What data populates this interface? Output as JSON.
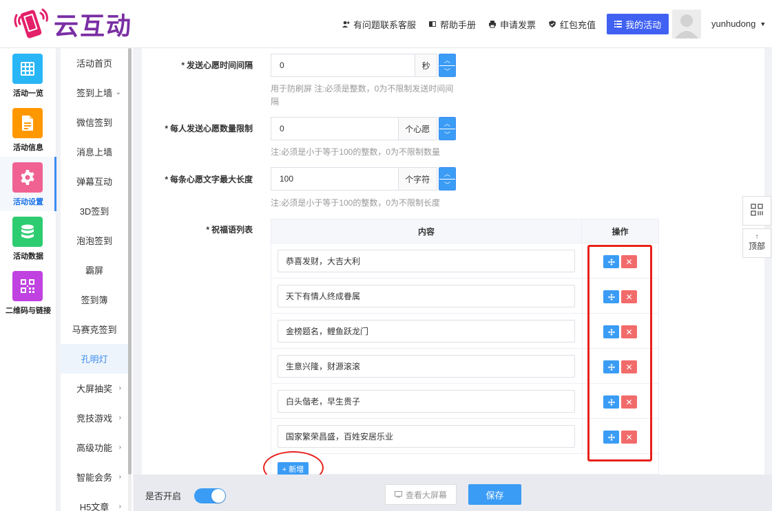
{
  "brand": {
    "name": "云互动",
    "colors": {
      "brand_purple": "#7a2ea3",
      "primary": "#3b9cf5",
      "nav_button": "#4061f2",
      "danger": "#f26b6b",
      "annotation": "#e8201b"
    }
  },
  "header": {
    "links": [
      {
        "label": "有问题联系客服",
        "icon": "user-plus-icon"
      },
      {
        "label": "帮助手册",
        "icon": "book-icon"
      },
      {
        "label": "申请发票",
        "icon": "printer-icon"
      },
      {
        "label": "红包充值",
        "icon": "shield-check-icon"
      }
    ],
    "my_activity": "我的活动",
    "username": "yunhudong"
  },
  "rail": [
    {
      "label": "活动一览",
      "icon": "grid-icon",
      "color": "#29b6f6"
    },
    {
      "label": "活动信息",
      "icon": "document-icon",
      "color": "#ff9800"
    },
    {
      "label": "活动设置",
      "icon": "gear-icon",
      "color": "#f06292",
      "active": true
    },
    {
      "label": "活动数据",
      "icon": "database-icon",
      "color": "#2ecc71"
    },
    {
      "label": "二维码与链接",
      "icon": "qrcode-icon",
      "color": "#c042e0"
    }
  ],
  "submenu": [
    {
      "label": "活动首页"
    },
    {
      "label": "签到上墙",
      "chevron": "⌄"
    },
    {
      "label": "微信签到"
    },
    {
      "label": "消息上墙"
    },
    {
      "label": "弹幕互动"
    },
    {
      "label": "3D签到"
    },
    {
      "label": "泡泡签到"
    },
    {
      "label": "霸屏"
    },
    {
      "label": "签到簿"
    },
    {
      "label": "马赛克签到"
    },
    {
      "label": "孔明灯",
      "active": true
    },
    {
      "label": "大屏抽奖",
      "chevron": "›"
    },
    {
      "label": "竞技游戏",
      "chevron": "›"
    },
    {
      "label": "高级功能",
      "chevron": "›"
    },
    {
      "label": "智能会务",
      "chevron": "›"
    },
    {
      "label": "H5文章",
      "chevron": "›"
    }
  ],
  "form": {
    "interval": {
      "label": "发送心愿时间间隔",
      "value": "0",
      "unit": "秒",
      "hint": "用于防刷屏 注:必须是整数，0为不限制发送时间间隔"
    },
    "count": {
      "label": "每人发送心愿数量限制",
      "value": "0",
      "unit": "个心愿",
      "hint": "注:必须是小于等于100的整数，0为不限制数量"
    },
    "length": {
      "label": "每条心愿文字最大长度",
      "value": "100",
      "unit": "个字符",
      "hint": "注:必须是小于等于100的整数，0为不限制长度"
    },
    "blessings": {
      "label": "祝福语列表",
      "col_content": "内容",
      "col_action": "操作",
      "rows": [
        "恭喜发财，大吉大利",
        "天下有情人终成眷属",
        "金榜题名，鲤鱼跃龙门",
        "生意兴隆，财源滚滚",
        "白头偕老，早生贵子",
        "国家繁荣昌盛，百姓安居乐业"
      ],
      "add_label": "+ 新增"
    }
  },
  "bottom": {
    "toggle_label": "是否开启",
    "toggle_on": true,
    "view_label": "查看大屏幕",
    "save_label": "保存"
  },
  "float": {
    "top_label": "顶部",
    "top_arrow": "↑"
  }
}
